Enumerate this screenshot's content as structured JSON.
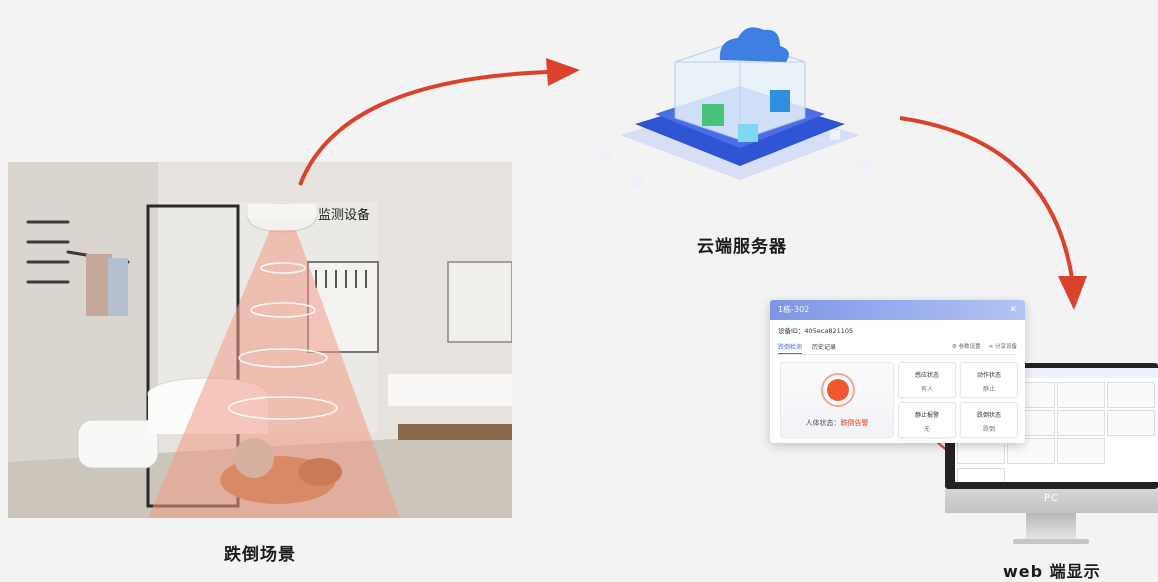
{
  "labels": {
    "scene_caption": "跌倒场景",
    "device_label": "监测设备",
    "server_caption": "云端服务器",
    "web_caption": "web 端显示"
  },
  "popup": {
    "title": "1栋-302",
    "close_icon": "close-icon",
    "device_id_label": "设备ID：405eca821105",
    "tabs": [
      "跌倒检测",
      "历史记录"
    ],
    "actions": [
      "参数设置",
      "分享设备"
    ],
    "human_state_label": "人体状态：",
    "human_state_value": "跌倒告警",
    "cards": [
      {
        "title": "感应状态",
        "value": "有人"
      },
      {
        "title": "动作状态",
        "value": "静止"
      },
      {
        "title": "静止报警",
        "value": "无"
      },
      {
        "title": "跌倒状态",
        "value": "跌倒"
      }
    ]
  },
  "monitor": {
    "brand": "PC"
  },
  "colors": {
    "arrow": "#d9432c",
    "alert": "#e23f2a",
    "popup_header": "#7e95e6",
    "server_base": "#2f55d4"
  }
}
